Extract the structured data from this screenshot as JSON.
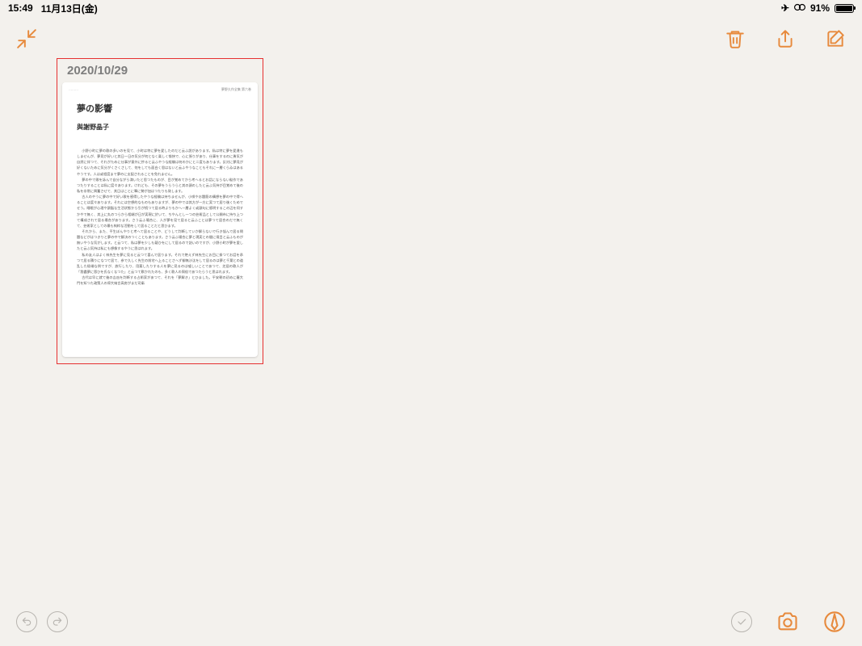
{
  "status": {
    "time": "15:49",
    "date": "11月13日(金)",
    "battery_percent": "91%",
    "battery_fill": 91
  },
  "toolbar": {
    "collapse": "collapse",
    "delete": "delete",
    "share": "share",
    "compose": "compose"
  },
  "thumbnail": {
    "date": "2020/10/29",
    "header_left": "………",
    "header_right": "夢野久作全集 第六巻",
    "title": "夢の影響",
    "author": "與謝野晶子",
    "paragraphs": [
      "小野小町に夢の歌の多いのを見て、小町は特に夢を愛したのだと云ふ説があります。私は特に夢を愛違もしませんが、夢見が好いと其日一日の気分が何となく楽しく愉快で、心に張りがあり、仕事をするのに勇気が自然に伴つて、それがために仕事が意外に捗ると云ふやうな経験は何のかにと二度もあります。反対に夢見が好くないために気分がくさくさして、何をしても面白く思はないと云ふやうなこともそれに一層くらゐはあるやうです。人は或程度まで夢のに支配されることを免れません。",
      "夢の中で歌を詠んで自分ながら満いたと思つたものが、目が覚めてから考へるとお話にならない駄作であつたりすることは私に度々あります。けれども、その夢をうらうらと其の頭のしたと云ふ気持が目覚めて後の私を非常に興奮させて、其日はことに筆に勢が加はつたりも致します。",
      "古人のやうに夢の中で好い歌を感得したやうな経験は持ちませんが、小唄やお題筋の構想を夢の中で得へることは度々あります。それには空想的なものもありますが、夢の中では其方が一方に実つて居り後くためでせう。睡眠が心理や頭脳な生活状態から引が続つて居る時よりもかへ一層よく或頭句に感明するこの辺を伺すかやで無く、其上に丸のつらから相端が日が実現に於いて、ちやんとし一つの芸術品として公開市に持ち上つて構成されて居る場合があります。さう云ふ場合に、人が夢を見て居ると云ふことは夢つて居合のだで無くて、芸術家としての最も純粋な活動をして居ることだと思ひます。",
      "それから、また、平生ぼんやりと考へて居ることや、どうして判断していか解らないで行き悩んで居る問題などがはつきりと夢の中で解決のつくこともあります。さう云ふ場合に夢と現実との間に境目と云ふものが無いやうな気がします。と云つて、私は夢を少しも疑ひをにして居るので詰いのですが、小野小町が夢を愛したと云ふ気持は私にも想像するやうに思はれます。",
      "私の友人はよく林先生を夢に見ると云つて喜んで居ります。それで絶えず林先生にお目に掛つてお話を承つて居る積りになつて居て、参で久しく先生の前宅へ上ることさへず御無沙汰をして居るのは夢と千葉との道乱した極端な例ですが、放行したり、用薬したりする人を夢に見るのは嘘しいことであつて、芝居の歌人が「我儘夢に恩ひを氏なくなつた」と云つて歎かれたのも、多く歌人の周俗であつたらうと思はれます。",
      "古代は早に就て後の吉凶を判断する占術家があつて、それを「夢解き」とひました。平安朝の初めに羅大門を知つた政策人の停大納言高房がまだ司衛"
    ]
  },
  "bottom": {
    "undo": "undo",
    "redo": "redo",
    "check": "done",
    "camera": "camera",
    "pen": "pen"
  },
  "colors": {
    "accent": "#e78a3d",
    "selection": "#e63030",
    "muted": "#b8b5b0"
  }
}
